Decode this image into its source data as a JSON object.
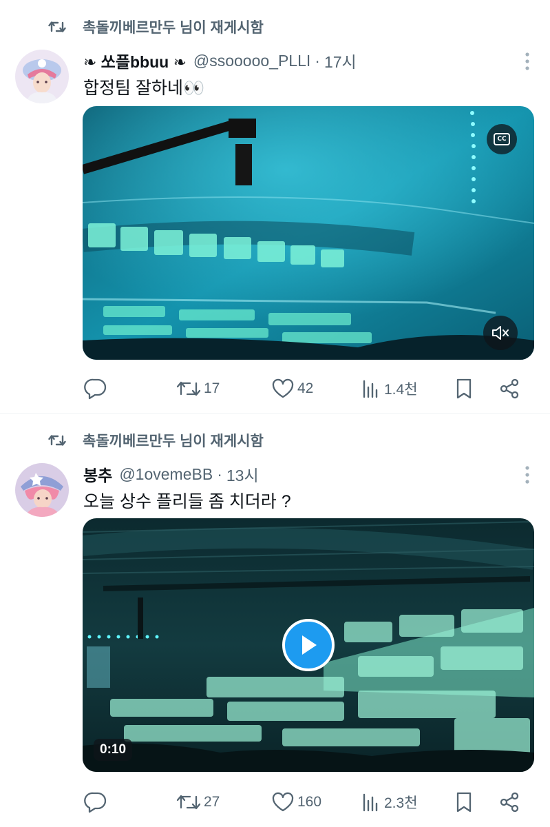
{
  "tweets": [
    {
      "repost_text": "촉돌끼베르만두 님이 재게시함",
      "name": "❧ 쏘플bbuu ❧",
      "handle": "@ssooooo_PLLI",
      "dot": "·",
      "time": "17시",
      "text": "합정팀 잘하네👀",
      "media": {
        "cc_label": "CC"
      },
      "stats": {
        "retweets": "17",
        "likes": "42",
        "views": "1.4천"
      }
    },
    {
      "repost_text": "촉돌끼베르만두 님이 재게시함",
      "name": "봉추",
      "handle": "@1ovemeBB",
      "dot": "·",
      "time": "13시",
      "text": "오늘 상수 플리들 좀 치더라 ?",
      "media": {
        "duration": "0:10"
      },
      "stats": {
        "retweets": "27",
        "likes": "160",
        "views": "2.3천"
      }
    }
  ],
  "colors": {
    "muted": "#536471",
    "text": "#0f1419",
    "accent": "#1d9bf0"
  }
}
